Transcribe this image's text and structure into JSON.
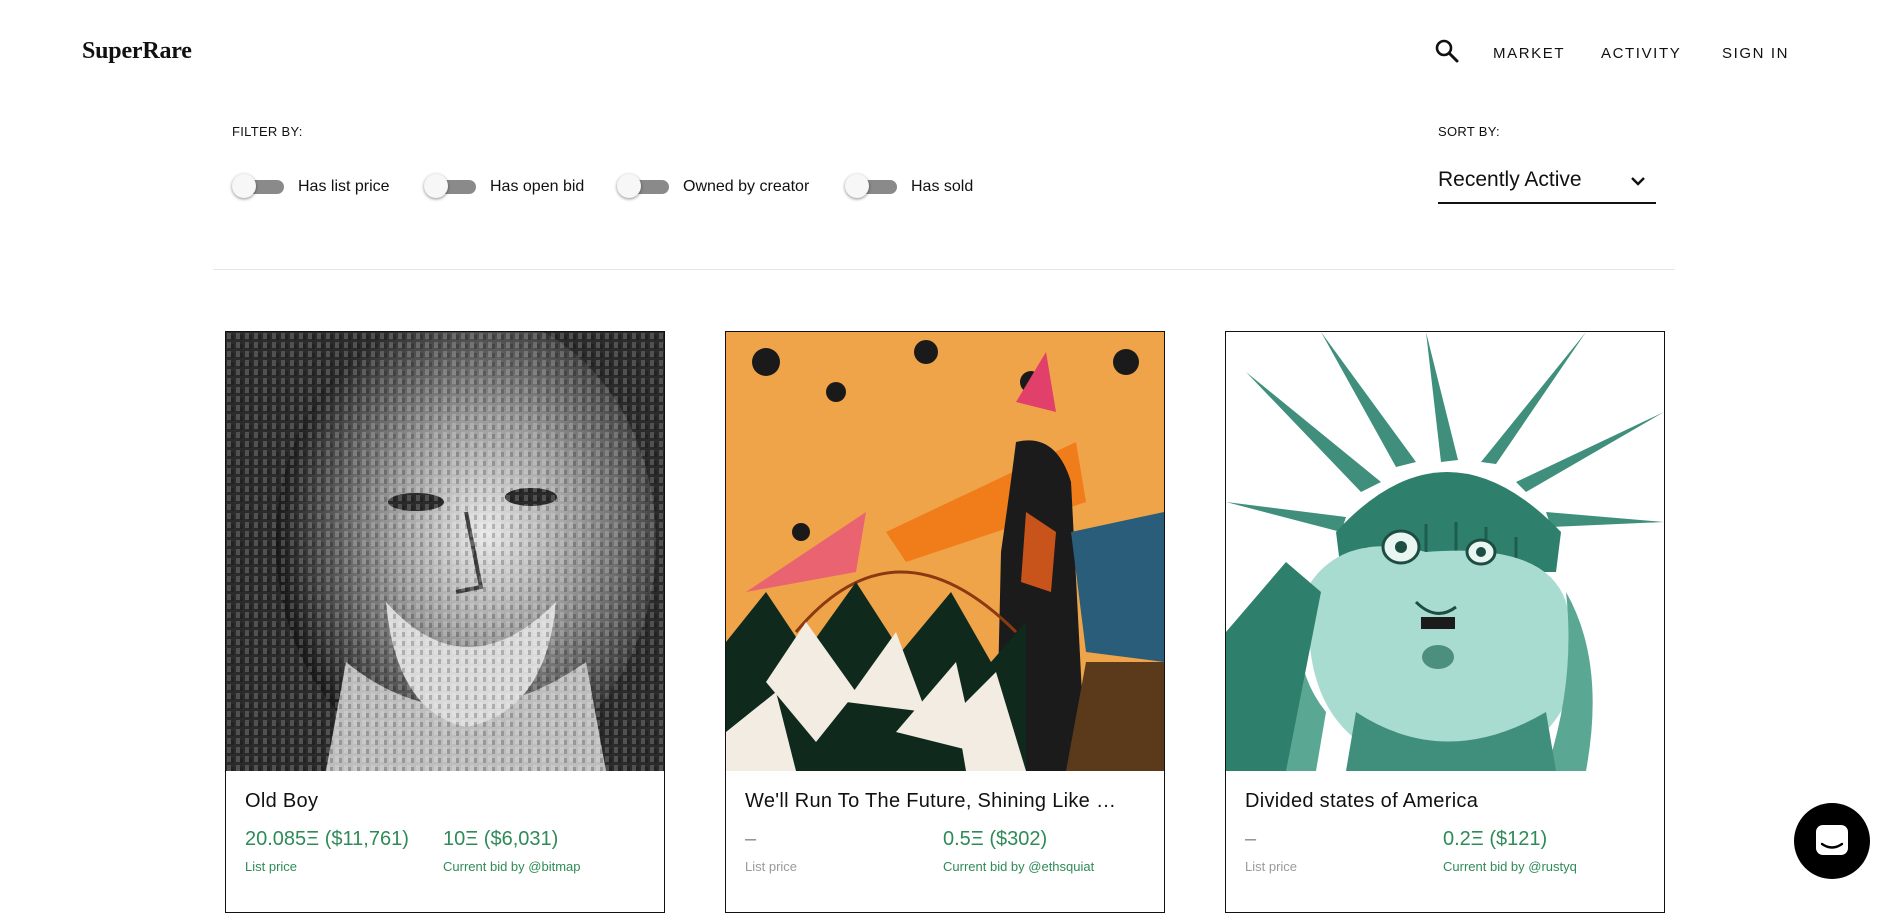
{
  "header": {
    "logo": "SuperRare",
    "search_icon": "search-icon",
    "nav": [
      "MARKET",
      "ACTIVITY",
      "SIGN IN"
    ]
  },
  "filters": {
    "label": "FILTER BY:",
    "toggles": [
      {
        "label": "Has list price",
        "on": false
      },
      {
        "label": "Has open bid",
        "on": false
      },
      {
        "label": "Owned by creator",
        "on": false
      },
      {
        "label": "Has sold",
        "on": false
      }
    ]
  },
  "sort": {
    "label": "SORT BY:",
    "selected": "Recently Active",
    "icon": "chevron-down-icon"
  },
  "cards": [
    {
      "title": "Old Boy",
      "list_price": "20.085Ξ ($11,761)",
      "list_label": "List price",
      "bid": "10Ξ ($6,031)",
      "bid_label": "Current bid by @bitmap"
    },
    {
      "title": "We'll Run To The Future, Shining Like …",
      "list_price": "–",
      "list_label": "List price",
      "bid": "0.5Ξ ($302)",
      "bid_label": "Current bid by @ethsquiat"
    },
    {
      "title": "Divided states of America",
      "list_price": "–",
      "list_label": "List price",
      "bid": "0.2Ξ ($121)",
      "bid_label": "Current bid by @rustyq"
    }
  ],
  "chat": {
    "icon": "chat-icon"
  },
  "colors": {
    "price_green": "#2e8b57",
    "toggle_track": "#8a8a8a",
    "text": "#111111"
  }
}
